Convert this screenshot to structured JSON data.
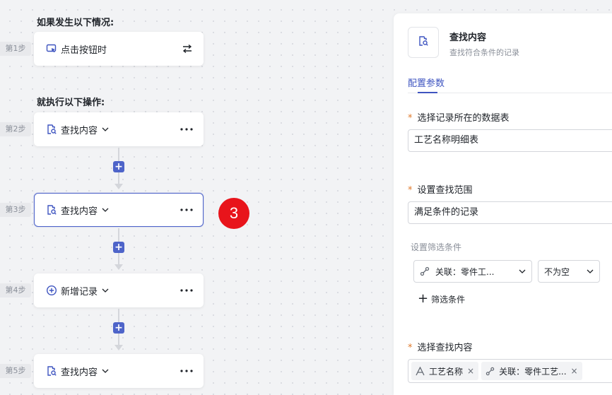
{
  "canvas": {
    "trigger_section_title": "如果发生以下情况:",
    "action_section_title": "就执行以下操作:",
    "steps": [
      {
        "step_label": "第1步",
        "title": "点击按钮时",
        "icon": "cursor-click-icon",
        "right_icon": "swap-icon"
      },
      {
        "step_label": "第2步",
        "title": "查找内容",
        "icon": "find-record-icon",
        "right_icon": "more-icon"
      },
      {
        "step_label": "第3步",
        "title": "查找内容",
        "icon": "find-record-icon",
        "right_icon": "more-icon",
        "selected": true
      },
      {
        "step_label": "第4步",
        "title": "新增记录",
        "icon": "add-circle-icon",
        "right_icon": "more-icon"
      },
      {
        "step_label": "第5步",
        "title": "查找内容",
        "icon": "find-record-icon",
        "right_icon": "more-icon"
      }
    ],
    "add_button_label": "+",
    "annotation_badge": "3"
  },
  "panel": {
    "title": "查找内容",
    "subtitle": "查找符合条件的记录",
    "tab_label": "配置参数",
    "required_star": "*",
    "table_label": "选择记录所在的数据表",
    "table_value": "工艺名称明细表",
    "scope_label": "设置查找范围",
    "scope_value": "满足条件的记录",
    "filter_label": "设置筛选条件",
    "filter_field": "关联：零件工...",
    "filter_operator": "不为空",
    "add_filter_label": "筛选条件",
    "content_label": "选择查找内容",
    "content_tags": [
      {
        "label": "工艺名称",
        "icon": "text-field-icon"
      },
      {
        "label": "关联：零件工艺...",
        "icon": "link-icon"
      }
    ],
    "tag_remove": "×"
  },
  "colors": {
    "accent": "#4e64c9",
    "tab_active": "#3f55c0",
    "required_star": "#e07a2c",
    "badge": "#e8141b"
  }
}
